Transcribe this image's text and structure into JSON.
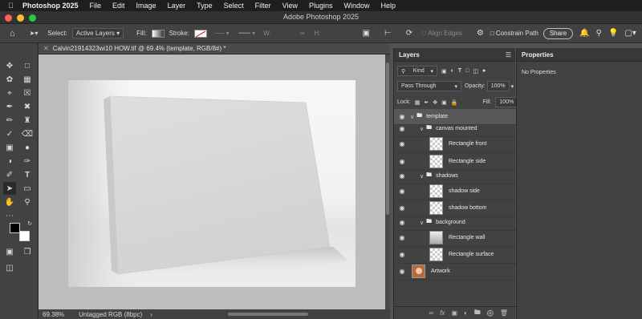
{
  "menubar": {
    "app": "Photoshop 2025",
    "items": [
      "File",
      "Edit",
      "Image",
      "Layer",
      "Type",
      "Select",
      "Filter",
      "View",
      "Plugins",
      "Window",
      "Help"
    ]
  },
  "window": {
    "title": "Adobe Photoshop 2025"
  },
  "options": {
    "select_label": "Select:",
    "select_value": "Active Layers",
    "fill_label": "Fill:",
    "stroke_label": "Stroke:",
    "w_label": "W:",
    "align_edges": "Align Edges",
    "constrain_path": "Constrain Path",
    "share": "Share"
  },
  "document": {
    "tab_title": "Calvin21914323wi10 HOW.tif @ 69.4% (template, RGB/8#) *",
    "zoom": "69.38%",
    "color_profile": "Untagged RGB (8bpc)"
  },
  "layers_panel": {
    "title": "Layers",
    "kind": "Kind",
    "blend_mode": "Pass Through",
    "opacity_label": "Opacity:",
    "opacity": "100%",
    "lock_label": "Lock:",
    "fill_label": "Fill:",
    "fill": "100%",
    "layers": [
      {
        "name": "template",
        "type": "group"
      },
      {
        "name": "canvas mounted",
        "type": "group"
      },
      {
        "name": "Rectangle front",
        "type": "layer"
      },
      {
        "name": "Rectangle side",
        "type": "layer"
      },
      {
        "name": "shadows",
        "type": "group"
      },
      {
        "name": "shadow side",
        "type": "layer"
      },
      {
        "name": "shadow bottom",
        "type": "layer"
      },
      {
        "name": "background",
        "type": "group"
      },
      {
        "name": "Rectangle wall",
        "type": "layer"
      },
      {
        "name": "Rectangle surface",
        "type": "layer"
      },
      {
        "name": "Artwork",
        "type": "image"
      }
    ]
  },
  "properties_panel": {
    "title": "Properties",
    "empty": "No Properties"
  },
  "colors": {
    "close": "#ff5f57",
    "minimize": "#febc2e",
    "zoom": "#28c840",
    "foreground": "#000000",
    "background": "#ffffff"
  }
}
